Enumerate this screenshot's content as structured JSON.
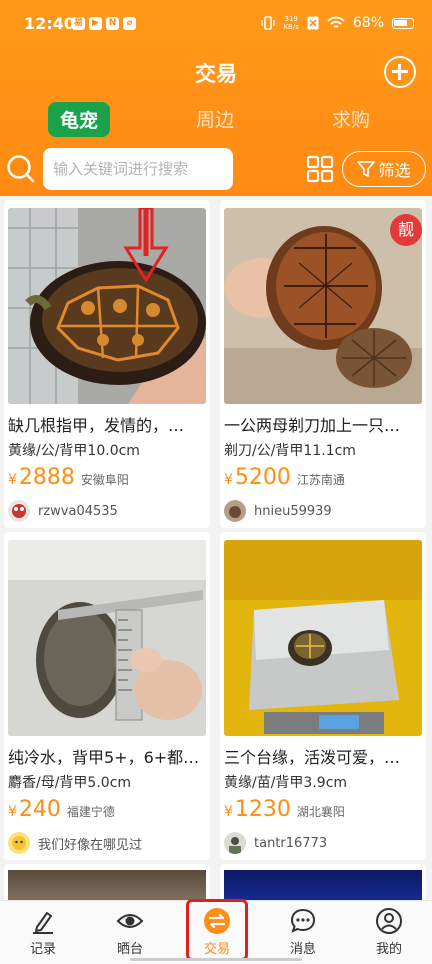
{
  "status_bar": {
    "time": "12:40",
    "app_badges": [
      "易",
      "▶",
      "N",
      "⌀"
    ],
    "net_speed_value": "319",
    "net_speed_unit": "KB/s",
    "battery_label": "68%"
  },
  "header": {
    "title": "交易"
  },
  "tabs": [
    {
      "label": "龟宠",
      "active": true
    },
    {
      "label": "周边",
      "active": false
    },
    {
      "label": "求购",
      "active": false
    }
  ],
  "search": {
    "placeholder": "输入关键词进行搜索",
    "filter_label": "筛选"
  },
  "listings": [
    {
      "title": "缺几根指甲，发情的，…",
      "spec": "黄缘/公/背甲10.0cm",
      "price": "2888",
      "location": "安徽阜阳",
      "user": "rzwva04535",
      "badge": ""
    },
    {
      "title": "一公两母剃刀加上一只…",
      "spec": "剃刀/公/背甲11.1cm",
      "price": "5200",
      "location": "江苏南通",
      "user": "hnieu59939",
      "badge": "靓"
    },
    {
      "title": "纯冷水，背甲5+，6+都…",
      "spec": "麝香/母/背甲5.0cm",
      "price": "240",
      "location": "福建宁德",
      "user": "我们好像在哪见过",
      "badge": ""
    },
    {
      "title": "三个台缘，活泼可爱，…",
      "spec": "黄缘/苗/背甲3.9cm",
      "price": "1230",
      "location": "湖北襄阳",
      "user": "tantr16773",
      "badge": ""
    }
  ],
  "currency_symbol": "¥",
  "bottom_nav": [
    {
      "label": "记录",
      "icon": "pen-icon"
    },
    {
      "label": "晒台",
      "icon": "eye-icon"
    },
    {
      "label": "交易",
      "icon": "exchange-icon",
      "active": true
    },
    {
      "label": "消息",
      "icon": "chat-icon"
    },
    {
      "label": "我的",
      "icon": "person-icon"
    }
  ],
  "colors": {
    "brand_orange": "#ff8d16",
    "tab_green": "#19a24a",
    "badge_red": "#e23a3a",
    "annotation_red": "#e02020"
  }
}
